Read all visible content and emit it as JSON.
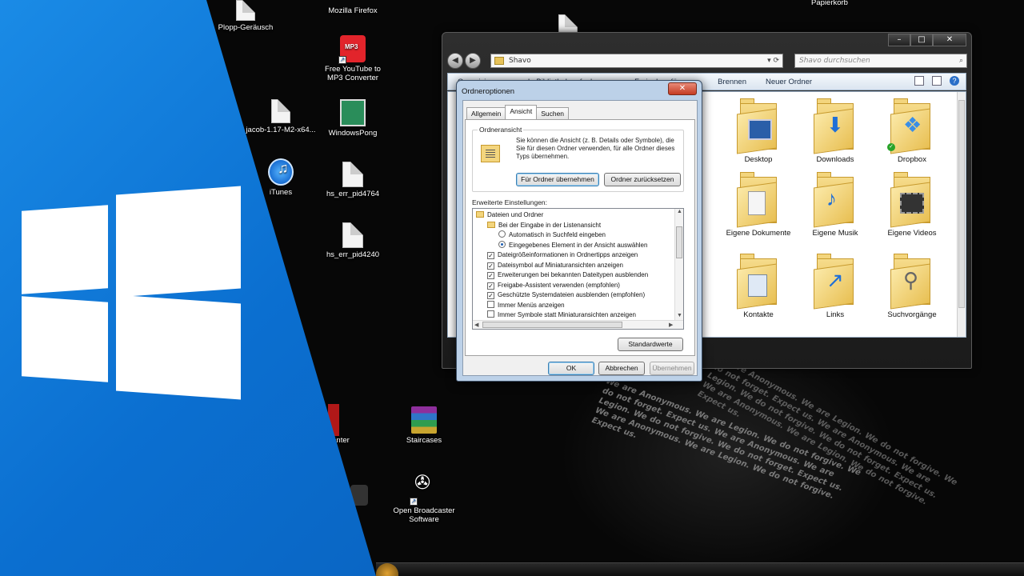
{
  "desktop": {
    "icons": [
      {
        "label": "Plopp-Geräusch"
      },
      {
        "label": "Mozilla Firefox"
      },
      {
        "label": "Free YouTube to MP3 Converter",
        "badge": "MP3"
      },
      {
        "label": "WindowsPong"
      },
      {
        "label": "jacob-1.17-M2-x64..."
      },
      {
        "label": "iTunes"
      },
      {
        "label": "hs_err_pid4764"
      },
      {
        "label": "hs_err_pid4240"
      },
      {
        "label": "Papierkorb"
      },
      {
        "label": "...enter"
      },
      {
        "label": "Staircases"
      },
      {
        "label": "Open Broadcaster Software"
      }
    ],
    "wallpaper_text": "We are Anonymous. We are Legion. We do not forgive. We do not forget. Expect us. We are Anonymous. We are Legion. We do not forgive. We do not forget. Expect us. We are Anonymous. We are Legion. We do not forgive. Expect us."
  },
  "explorer": {
    "address": "Shavo",
    "search_placeholder": "Shavo durchsuchen",
    "toolbar": {
      "organize": "Organisieren ▾",
      "library": "In Bibliothek aufnehmen ▾",
      "share": "Freigeben für ▾",
      "burn": "Brennen",
      "new_folder": "Neuer Ordner"
    },
    "folders": [
      {
        "label": "Desktop",
        "icon": "desktop-folder-icon"
      },
      {
        "label": "Downloads",
        "icon": "downloads-folder-icon"
      },
      {
        "label": "Dropbox",
        "icon": "dropbox-folder-icon"
      },
      {
        "label": "Eigene Dokumente",
        "icon": "documents-folder-icon"
      },
      {
        "label": "Eigene Musik",
        "icon": "music-folder-icon"
      },
      {
        "label": "Eigene Videos",
        "icon": "videos-folder-icon"
      },
      {
        "label": "Kontakte",
        "icon": "contacts-folder-icon"
      },
      {
        "label": "Links",
        "icon": "links-folder-icon"
      },
      {
        "label": "Suchvorgänge",
        "icon": "searches-folder-icon"
      }
    ]
  },
  "dialog": {
    "title": "Ordneroptionen",
    "tabs": [
      "Allgemein",
      "Ansicht",
      "Suchen"
    ],
    "active_tab": "Ansicht",
    "folder_view": {
      "legend": "Ordneransicht",
      "text": "Sie können die Ansicht (z. B. Details oder Symbole), die Sie für diesen Ordner verwenden, für alle Ordner dieses Typs übernehmen.",
      "apply_button": "Für Ordner übernehmen",
      "reset_button": "Ordner zurücksetzen"
    },
    "advanced_label": "Erweiterte Einstellungen:",
    "settings": [
      {
        "kind": "folder",
        "label": "Dateien und Ordner"
      },
      {
        "kind": "folder",
        "label": "Bei der Eingabe in der Listenansicht"
      },
      {
        "kind": "radio",
        "checked": false,
        "label": "Automatisch in Suchfeld eingeben"
      },
      {
        "kind": "radio",
        "checked": true,
        "label": "Eingegebenes Element in der Ansicht auswählen"
      },
      {
        "kind": "checkbox",
        "checked": true,
        "label": "Dateigrößeinformationen in Ordnertipps anzeigen"
      },
      {
        "kind": "checkbox",
        "checked": true,
        "label": "Dateisymbol auf Miniaturansichten anzeigen"
      },
      {
        "kind": "checkbox",
        "checked": true,
        "label": "Erweiterungen bei bekannten Dateitypen ausblenden"
      },
      {
        "kind": "checkbox",
        "checked": true,
        "label": "Freigabe-Assistent verwenden (empfohlen)"
      },
      {
        "kind": "checkbox",
        "checked": true,
        "label": "Geschützte Systemdateien ausblenden (empfohlen)"
      },
      {
        "kind": "checkbox",
        "checked": false,
        "label": "Immer Menüs anzeigen"
      },
      {
        "kind": "checkbox",
        "checked": false,
        "label": "Immer Symbole statt Miniaturansichten anzeigen"
      }
    ],
    "defaults_button": "Standardwerte",
    "ok_button": "OK",
    "cancel_button": "Abbrechen",
    "apply_button": "Übernehmen"
  }
}
